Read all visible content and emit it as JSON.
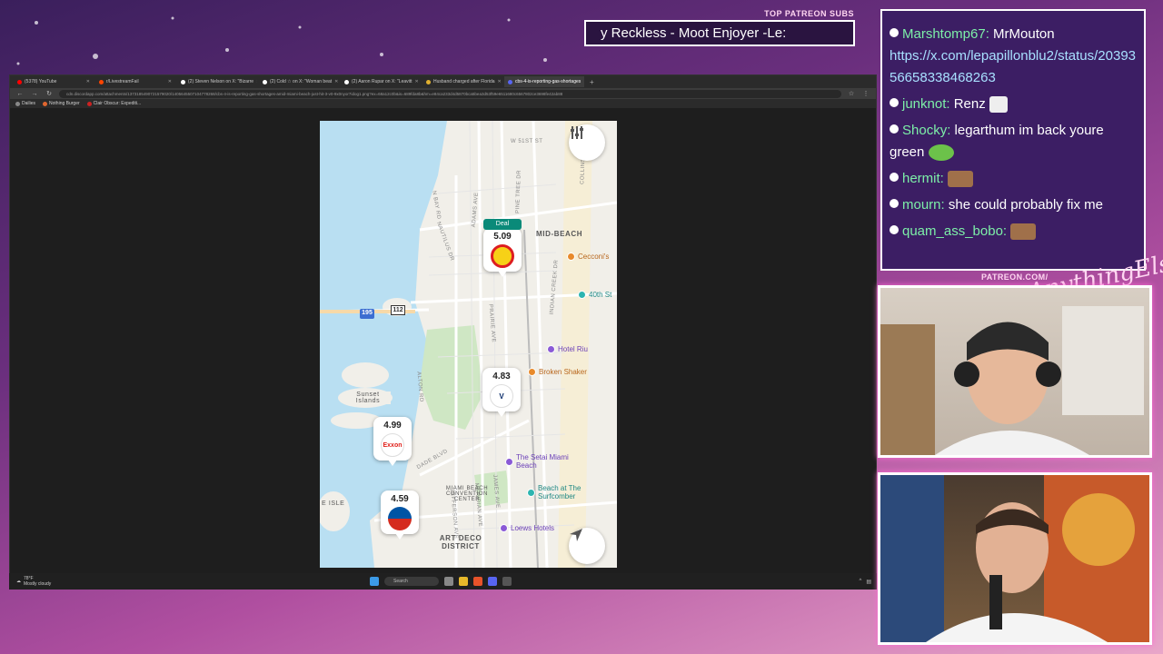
{
  "overlay": {
    "top_subs_label": "TOP PATREON SUBS",
    "ticker_text": "y Reckless - Moot Enjoyer -Le:",
    "patreon_label": "PATREON.COM/",
    "signature_text": "AnythingElse"
  },
  "browser": {
    "tabs": [
      {
        "label": "(5378) YouTube",
        "color": "#ff0000",
        "active": false
      },
      {
        "label": "r/LivestreamFail",
        "color": "#ff4500",
        "active": false
      },
      {
        "label": "(2) Steven Nelson on X: \"Bizarre",
        "color": "#ffffff",
        "active": false
      },
      {
        "label": "(2) Cold ☆ on X: \"Woman beat",
        "color": "#ffffff",
        "active": false
      },
      {
        "label": "(2) Aaron Rupar on X: \"Leavitt",
        "color": "#ffffff",
        "active": false
      },
      {
        "label": "Husband charged after Florida",
        "color": "#e0b030",
        "active": false
      },
      {
        "label": "cbs-4-is-reporting-gas-shortages",
        "color": "#5865f2",
        "active": true
      }
    ],
    "url": "cdn.discordapp.com/attachments/1373185490721579020/1405645507104778268/cbs-4-is-reporting-gas-shortages-amid-miami-beach-just-hit-3-v0-9x0nyor7idog1.png?ex=68a12c0b&is=689fda8b&hm=e84ca233d4d5870bca5bea3d53f59e6511680c6567802ce3698fe42ab88",
    "bookmarks": [
      {
        "label": "Dailies",
        "color": "#888888"
      },
      {
        "label": "Nothing Burger",
        "color": "#e0662f"
      },
      {
        "label": "Clair Obscur: Expediti...",
        "color": "#cc2222"
      }
    ]
  },
  "map": {
    "streets": [
      "W 51ST ST",
      "COLLINS AVE",
      "N BAY RD",
      "ADAMS AVE",
      "NAUTILUS DR",
      "PINE TREE DR",
      "INDIAN CREEK DR",
      "PRAIRIE AVE",
      "ALTON RD",
      "MERIDIAN AVE",
      "DADE BLVD",
      "JAMES AVE",
      "JEFFERSON AVE"
    ],
    "areas": [
      "MID-BEACH",
      "Sunset Islands",
      "MIAMI BEACH CONVENTION CENTER",
      "ART DECO DISTRICT",
      "E ISLE"
    ],
    "highway_shields": [
      "195",
      "112"
    ],
    "pois": [
      {
        "label": "Cecconi's",
        "color": "#e88a2b"
      },
      {
        "label": "40th St",
        "color": "#2cb5b0"
      },
      {
        "label": "Hotel Riu",
        "color": "#8a5ad6"
      },
      {
        "label": "Broken Shaker",
        "color": "#e88a2b"
      },
      {
        "label": "The Setai Miami Beach",
        "color": "#8a5ad6"
      },
      {
        "label": "Beach at The Surfcomber",
        "color": "#2cb5b0"
      },
      {
        "label": "Loews Hotels",
        "color": "#8a5ad6"
      }
    ],
    "stations": [
      {
        "price": "5.09",
        "brand": "Shell",
        "deal": "Deal"
      },
      {
        "price": "4.83",
        "brand": "Valero",
        "deal": ""
      },
      {
        "price": "4.99",
        "brand": "Exxon",
        "deal": ""
      },
      {
        "price": "4.59",
        "brand": "Chevron",
        "deal": ""
      }
    ],
    "filter_icon": "sliders-icon",
    "locate_icon": "navigation-arrow-icon"
  },
  "taskbar": {
    "weather_temp": "78°F",
    "weather_desc": "Mostly cloudy",
    "search_placeholder": "Search"
  },
  "chat": {
    "messages": [
      {
        "user": "Marshtomp67:",
        "text": " MrMouton",
        "link": "https://x.com/lepapillonblu2/status/2039356658338468263",
        "emote": ""
      },
      {
        "user": "junknot:",
        "text": " Renz ",
        "link": "",
        "emote": "ghost-emote"
      },
      {
        "user": "Shocky:",
        "text": " legarthum im back youre green ",
        "link": "",
        "emote": "green-blob-emote"
      },
      {
        "user": "hermit:",
        "text": " ",
        "link": "",
        "emote": "face-emote"
      },
      {
        "user": "mourn:",
        "text": " she could probably fix me",
        "link": "",
        "emote": ""
      },
      {
        "user": "quam_ass_bobo:",
        "text": " ",
        "link": "",
        "emote": "face-emote"
      }
    ]
  },
  "colors": {
    "chat_bg": "#3c1e64",
    "username": "#7df0a8",
    "map_water": "#b9dff2",
    "deal_badge": "#0a8a79"
  }
}
